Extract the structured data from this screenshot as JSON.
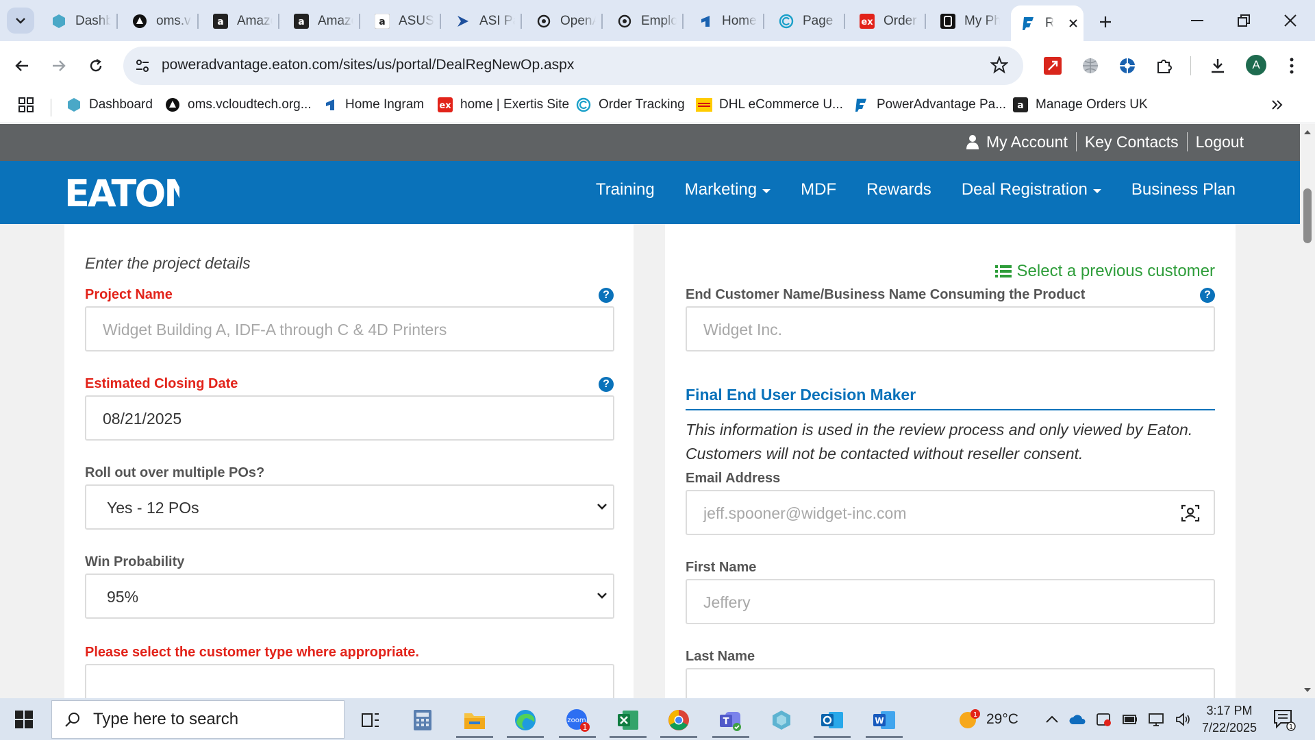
{
  "browser": {
    "tabs": [
      {
        "title": "Dashboard",
        "icon": "dashboard-hex-icon"
      },
      {
        "title": "oms.vcloudtech",
        "icon": "oms-icon"
      },
      {
        "title": "Amazon",
        "icon": "amazon-icon"
      },
      {
        "title": "Amazon",
        "icon": "amazon-icon"
      },
      {
        "title": "ASUS",
        "icon": "amazon-icon"
      },
      {
        "title": "ASI Partner",
        "icon": "asi-arrow-icon"
      },
      {
        "title": "OpenAI",
        "icon": "openai-icon"
      },
      {
        "title": "Employee",
        "icon": "openai-icon"
      },
      {
        "title": "Home",
        "icon": "ingram-icon"
      },
      {
        "title": "Page",
        "icon": "c-circle-icon"
      },
      {
        "title": "Order",
        "icon": "exertis-icon"
      },
      {
        "title": "My Phone",
        "icon": "myphone-icon"
      },
      {
        "title": "R",
        "icon": "poweradvantage-icon",
        "active": true
      }
    ],
    "url": "poweradvantage.eaton.com/sites/us/portal/DealRegNewOp.aspx",
    "profile_initial": "A",
    "bookmarks": [
      {
        "label": "Dashboard",
        "icon": "dashboard-hex-icon"
      },
      {
        "label": "oms.vcloudtech.org...",
        "icon": "oms-icon"
      },
      {
        "label": "Home Ingram",
        "icon": "ingram-icon"
      },
      {
        "label": "home | Exertis Site",
        "icon": "exertis-icon"
      },
      {
        "label": "Order Tracking",
        "icon": "c-circle-icon"
      },
      {
        "label": "DHL eCommerce U...",
        "icon": "dhl-icon"
      },
      {
        "label": "PowerAdvantage Pa...",
        "icon": "poweradvantage-icon"
      },
      {
        "label": "Manage Orders UK",
        "icon": "amazon-icon"
      }
    ]
  },
  "site": {
    "util_links": [
      "My Account",
      "Key Contacts",
      "Logout"
    ],
    "brand": "EATON",
    "nav": [
      {
        "label": "Training",
        "dropdown": false
      },
      {
        "label": "Marketing",
        "dropdown": true
      },
      {
        "label": "MDF",
        "dropdown": false
      },
      {
        "label": "Rewards",
        "dropdown": false
      },
      {
        "label": "Deal Registration",
        "dropdown": true
      },
      {
        "label": "Business Plan",
        "dropdown": false
      }
    ]
  },
  "form": {
    "left": {
      "intro": "Enter the project details",
      "project_name_label": "Project Name",
      "project_name_placeholder": "Widget Building A, IDF-A through C & 4D Printers",
      "closing_date_label": "Estimated Closing Date",
      "closing_date_value": "08/21/2025",
      "rollout_label": "Roll out over multiple POs?",
      "rollout_value": "Yes - 12 POs",
      "win_prob_label": "Win Probability",
      "win_prob_value": "95%",
      "customer_type_label": "Please select the customer type where appropriate."
    },
    "right": {
      "select_previous": "Select a previous customer",
      "end_customer_label": "End Customer Name/Business Name Consuming the Product",
      "end_customer_placeholder": "Widget Inc.",
      "section_title": "Final End User Decision Maker",
      "section_info": "This information is used in the review process and only viewed by Eaton. Customers will not be contacted without reseller consent.",
      "email_label": "Email Address",
      "email_placeholder": "jeff.spooner@widget-inc.com",
      "first_name_label": "First Name",
      "first_name_placeholder": "Jeffery",
      "last_name_label": "Last Name"
    }
  },
  "taskbar": {
    "search_placeholder": "Type here to search",
    "temperature": "29°C",
    "time": "3:17 PM",
    "date": "7/22/2025",
    "weather_badge": "1",
    "zoom_badge": "1",
    "notification_badge": "1"
  },
  "colors": {
    "eaton_blue": "#0a72ba",
    "required_red": "#e2231a",
    "link_green": "#2e9d3a",
    "util_gray": "#5f6264"
  }
}
